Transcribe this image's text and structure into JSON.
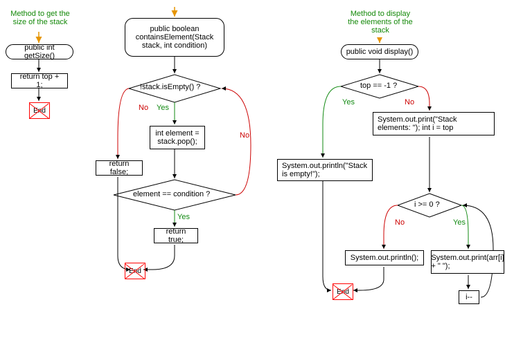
{
  "fc1": {
    "comment": "Method to get the size of the stack",
    "method": "public int getSize()",
    "stmt": "return top + 1;",
    "end": "End"
  },
  "fc2": {
    "method": "public boolean containsElement(Stack stack, int condition)",
    "cond1": "!stack.isEmpty() ?",
    "stmt1": "int element = stack.pop();",
    "retFalse": "return false;",
    "cond2": "element == condition ?",
    "retTrue": "return true;",
    "end": "End",
    "yes": "Yes",
    "no": "No"
  },
  "fc3": {
    "comment": "Method to display the elements of the stack",
    "method": "public void display()",
    "cond1": "top == -1 ?",
    "empty": "System.out.println(\"Stack is empty!\");",
    "header": "System.out.print(\"Stack elements: \"); int i = top",
    "cond2": "i >= 0 ?",
    "println": "System.out.println();",
    "print": "System.out.print(arr[i] + \" \");",
    "decr": "i--",
    "end": "End",
    "yes": "Yes",
    "no": "No"
  }
}
